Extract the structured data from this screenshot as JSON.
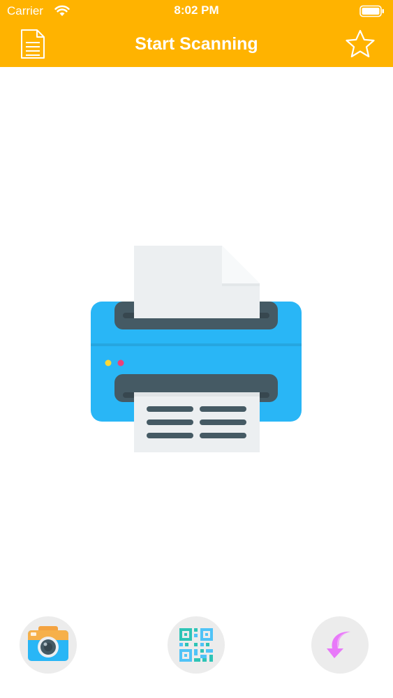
{
  "status_bar": {
    "carrier": "Carrier",
    "time": "8:02 PM"
  },
  "nav": {
    "title": "Start Scanning",
    "left_icon": "document-icon",
    "right_icon": "star-icon"
  },
  "hero": {
    "icon": "printer-icon"
  },
  "bottom_actions": [
    {
      "icon": "camera-icon"
    },
    {
      "icon": "qr-code-icon"
    },
    {
      "icon": "import-arrow-icon"
    }
  ],
  "colors": {
    "accent": "#FFB300",
    "printer_body": "#29B6F6",
    "printer_dark": "#455A64",
    "paper": "#ECEFF1",
    "import_arrow": "#E879F9"
  }
}
